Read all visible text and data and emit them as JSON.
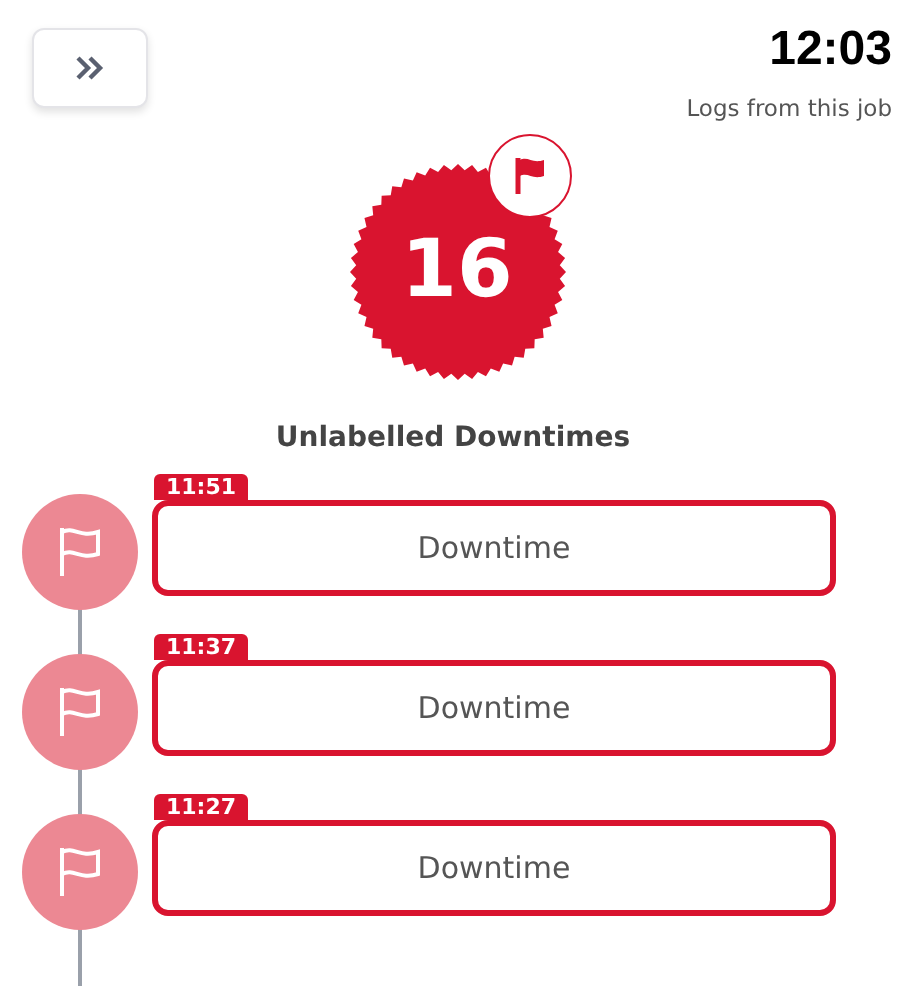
{
  "header": {
    "time": "12:03",
    "subtitle": "Logs from this job"
  },
  "summary": {
    "count": "16",
    "title": "Unlabelled Downtimes"
  },
  "entries": [
    {
      "time": "11:51",
      "label": "Downtime"
    },
    {
      "time": "11:37",
      "label": "Downtime"
    },
    {
      "time": "11:27",
      "label": "Downtime"
    }
  ]
}
